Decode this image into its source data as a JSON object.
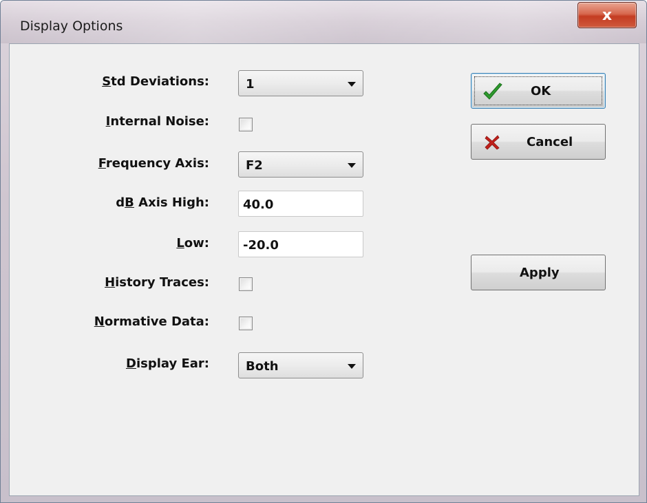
{
  "window": {
    "title": "Display Options",
    "close_glyph": "x"
  },
  "fields": {
    "std_deviations": {
      "label_u": "S",
      "label_rest": "td Deviations:",
      "value": "1",
      "options": [
        "1"
      ]
    },
    "internal_noise": {
      "label_u": "I",
      "label_rest": "nternal Noise:",
      "checked": false
    },
    "frequency_axis": {
      "label_u": "F",
      "label_rest": "requency Axis:",
      "value": "F2"
    },
    "db_axis_high": {
      "label_pre": "d",
      "label_u": "B",
      "label_rest": " Axis High:",
      "value": "40.0"
    },
    "low": {
      "label_u": "L",
      "label_rest": "ow:",
      "value": "-20.0"
    },
    "history_traces": {
      "label_u": "H",
      "label_rest": "istory Traces:",
      "checked": false
    },
    "normative_data": {
      "label_u": "N",
      "label_rest": "ormative Data:",
      "checked": false
    },
    "display_ear": {
      "label_u": "D",
      "label_rest": "isplay Ear:",
      "value": "Both"
    }
  },
  "buttons": {
    "ok": {
      "label": "OK",
      "icon": "checkmark-icon",
      "icon_color": "#2e9a2e"
    },
    "cancel": {
      "label": "Cancel",
      "icon": "x-icon",
      "icon_color": "#c0201b"
    },
    "apply": {
      "label": "Apply"
    }
  }
}
